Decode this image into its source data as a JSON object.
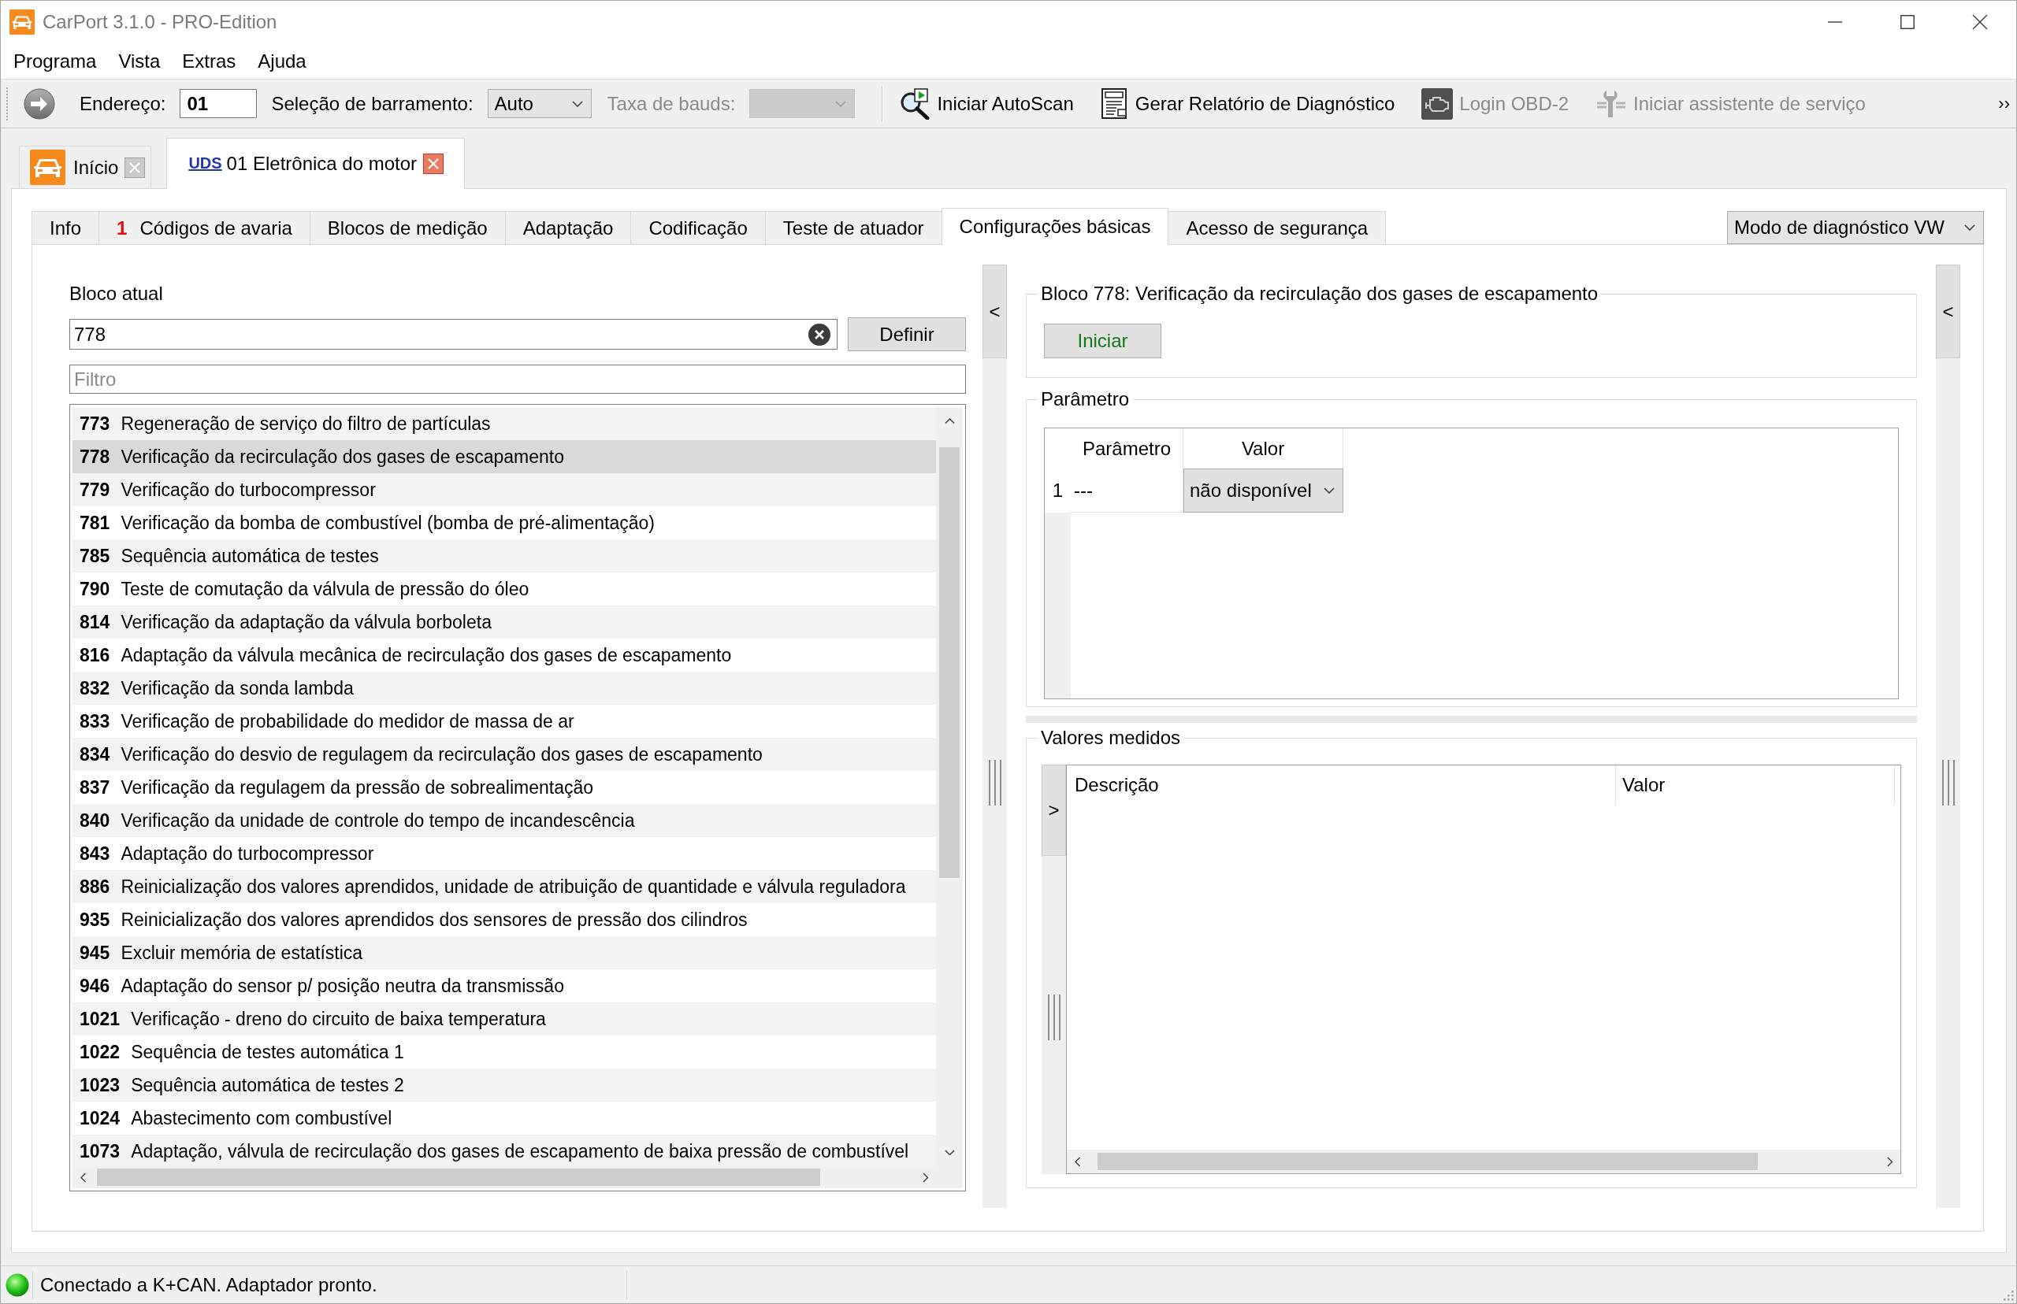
{
  "window": {
    "title": "CarPort 3.1.0 - PRO-Edition"
  },
  "menu": [
    {
      "label": "Programa"
    },
    {
      "label": "Vista"
    },
    {
      "label": "Extras"
    },
    {
      "label": "Ajuda"
    }
  ],
  "toolbar": {
    "address": {
      "label": "Endereço:",
      "value": "01"
    },
    "bus": {
      "label": "Seleção de barramento:",
      "value": "Auto"
    },
    "baud": {
      "label": "Taxa de bauds:",
      "disabled": true
    },
    "actions": [
      {
        "kind": "autoscan",
        "label": "Iniciar AutoScan",
        "disabled": false
      },
      {
        "kind": "report",
        "label": "Gerar Relatório de Diagnóstico",
        "disabled": false
      },
      {
        "kind": "engine",
        "label": "Login OBD-2",
        "disabled": true
      },
      {
        "kind": "service",
        "label": "Iniciar assistente de serviço",
        "disabled": true
      }
    ],
    "overflow": "››"
  },
  "document_tabs": [
    {
      "kind": "home",
      "label": "Início",
      "selected": false
    },
    {
      "kind": "module",
      "badge": "UDS",
      "label": "01 Eletrônica do motor",
      "selected": true
    }
  ],
  "function_tabs": [
    {
      "label": "Info",
      "selected": false
    },
    {
      "count": "1",
      "label": "Códigos de avaria",
      "selected": false
    },
    {
      "label": "Blocos de medição",
      "selected": false
    },
    {
      "label": "Adaptação",
      "selected": false
    },
    {
      "label": "Codificação",
      "selected": false
    },
    {
      "label": "Teste de atuador",
      "selected": false
    },
    {
      "label": "Configurações básicas",
      "selected": true
    },
    {
      "label": "Acesso de segurança",
      "selected": false
    }
  ],
  "mode_select": {
    "value": "Modo de diagnóstico VW"
  },
  "block_panel": {
    "label": "Bloco atual",
    "value": "778",
    "set_button": "Definir",
    "filter_placeholder": "Filtro",
    "blocks": [
      {
        "number": "773",
        "text": "Regeneração de serviço do filtro de partículas",
        "selected": false
      },
      {
        "number": "778",
        "text": "Verificação da recirculação dos gases de escapamento",
        "selected": true
      },
      {
        "number": "779",
        "text": "Verificação do turbocompressor",
        "selected": false
      },
      {
        "number": "781",
        "text": "Verificação da bomba de combustível (bomba de pré-alimentação)",
        "selected": false
      },
      {
        "number": "785",
        "text": "Sequência automática de testes",
        "selected": false
      },
      {
        "number": "790",
        "text": "Teste de comutação da válvula de pressão do óleo",
        "selected": false
      },
      {
        "number": "814",
        "text": "Verificação da adaptação da válvula borboleta",
        "selected": false
      },
      {
        "number": "816",
        "text": "Adaptação da válvula mecânica de recirculação dos gases de escapamento",
        "selected": false
      },
      {
        "number": "832",
        "text": "Verificação da sonda lambda",
        "selected": false
      },
      {
        "number": "833",
        "text": "Verificação de probabilidade do medidor de massa de ar",
        "selected": false
      },
      {
        "number": "834",
        "text": "Verificação do desvio de regulagem da recirculação dos gases de escapamento",
        "selected": false
      },
      {
        "number": "837",
        "text": "Verificação da regulagem da pressão de sobrealimentação",
        "selected": false
      },
      {
        "number": "840",
        "text": "Verificação da unidade de controle do tempo de incandescência",
        "selected": false
      },
      {
        "number": "843",
        "text": "Adaptação do turbocompressor",
        "selected": false
      },
      {
        "number": "886",
        "text": "Reinicialização dos valores aprendidos, unidade de atribuição de quantidade e válvula reguladora",
        "selected": false
      },
      {
        "number": "935",
        "text": "Reinicialização dos valores aprendidos dos sensores de pressão dos cilindros",
        "selected": false
      },
      {
        "number": "945",
        "text": "Excluir memória de estatística",
        "selected": false
      },
      {
        "number": "946",
        "text": "Adaptação do sensor p/ posição neutra da transmissão",
        "selected": false
      },
      {
        "number": "1021",
        "text": "Verificação - dreno do circuito de baixa temperatura",
        "selected": false
      },
      {
        "number": "1022",
        "text": "Sequência de testes automática 1",
        "selected": false
      },
      {
        "number": "1023",
        "text": "Sequência automática de testes 2",
        "selected": false
      },
      {
        "number": "1024",
        "text": "Abastecimento com combustível",
        "selected": false
      },
      {
        "number": "1073",
        "text": "Adaptação, válvula de recirculação dos gases de escapamento de baixa pressão de combustível",
        "selected": false
      }
    ]
  },
  "left_splitter": {
    "toggle": "<"
  },
  "selected_block": {
    "title": "Bloco 778: Verificação da recirculação dos gases de escapamento",
    "start_button": "Iniciar"
  },
  "parameters": {
    "title": "Parâmetro",
    "columns": [
      "Parâmetro",
      "Valor"
    ],
    "rows": [
      {
        "index": "1",
        "name": "---",
        "value": "não disponível"
      }
    ]
  },
  "measured_values": {
    "title": "Valores medidos",
    "toggle": ">",
    "columns": [
      "Descrição",
      "Valor"
    ]
  },
  "right_splitter": {
    "toggle": "<"
  },
  "status_bar": {
    "connected": true,
    "text": "Conectado a K+CAN. Adaptador pronto."
  }
}
